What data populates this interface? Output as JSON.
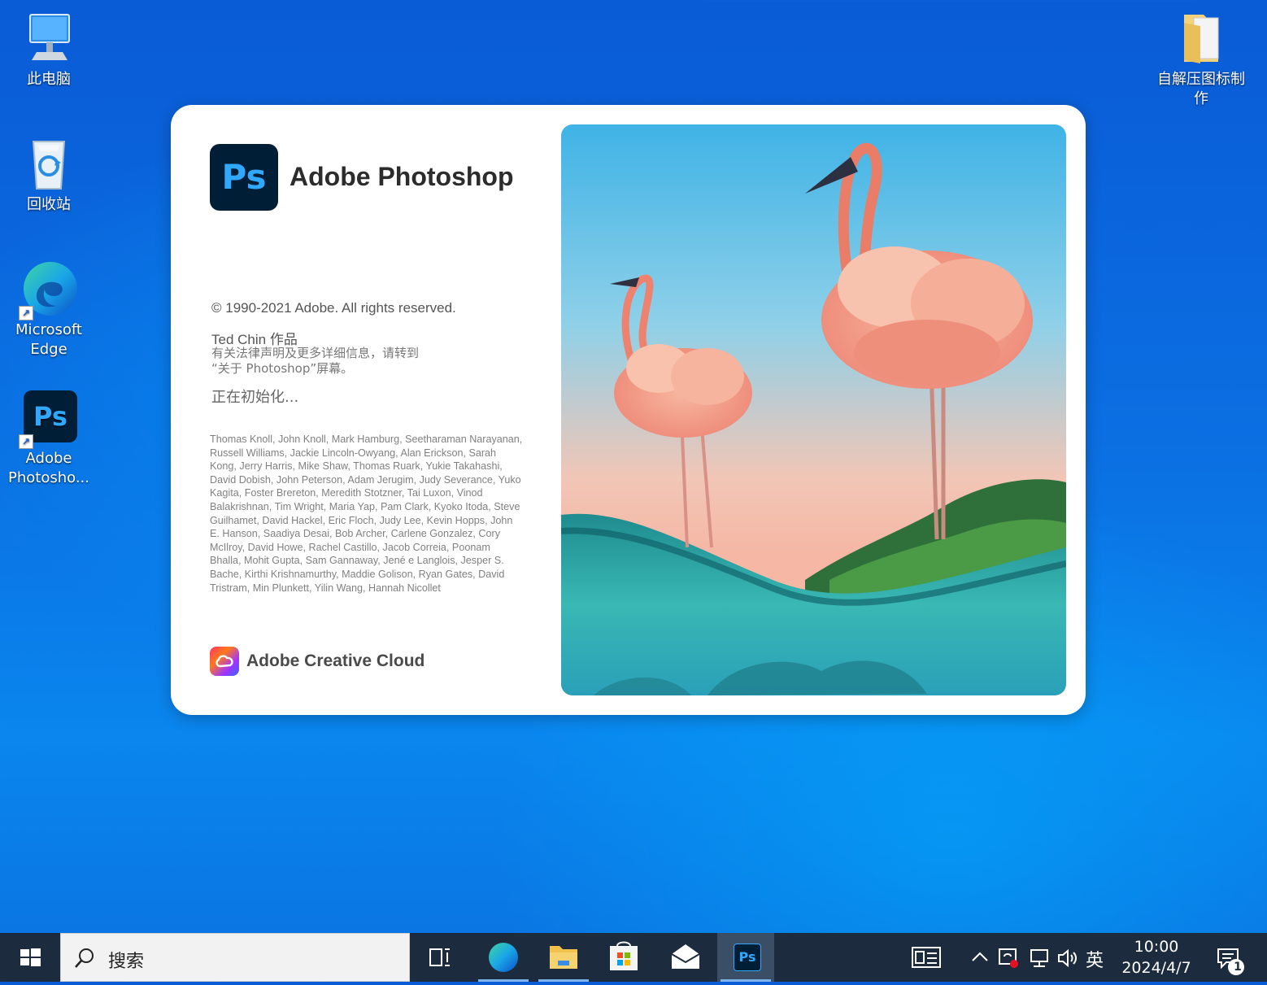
{
  "desktop": {
    "icons": [
      {
        "label": "此电脑"
      },
      {
        "label": "回收站"
      },
      {
        "label_line1": "Microsoft",
        "label_line2": "Edge"
      },
      {
        "label_line1": "Adobe",
        "label_line2": "Photosho..."
      },
      {
        "label_line1": "自解压图标制",
        "label_line2": "作"
      }
    ]
  },
  "splash": {
    "logo_text": "Ps",
    "title": "Adobe Photoshop",
    "copyright": "© 1990-2021 Adobe. All rights reserved.",
    "author": "Ted Chin 作品",
    "legal_line1": "有关法律声明及更多详细信息，请转到",
    "legal_line2": "“关于 Photoshop”屏幕。",
    "status": "正在初始化...",
    "credits": "Thomas Knoll, John Knoll, Mark Hamburg, Seetharaman Narayanan, Russell Williams, Jackie Lincoln-Owyang, Alan Erickson, Sarah Kong, Jerry Harris, Mike Shaw, Thomas Ruark, Yukie Takahashi, David Dobish, John Peterson, Adam Jerugim, Judy Severance, Yuko Kagita, Foster Brereton, Meredith Stotzner, Tai Luxon, Vinod Balakrishnan, Tim Wright, Maria Yap, Pam Clark, Kyoko Itoda, Steve Guilhamet, David Hackel, Eric Floch, Judy Lee, Kevin Hopps, John E. Hanson, Saadiya Desai, Bob Archer, Carlene Gonzalez, Cory McIlroy, David Howe, Rachel Castillo, Jacob Correia, Poonam Bhalla, Mohit Gupta, Sam Gannaway, Jené e Langlois, Jesper S. Bache, Kirthi Krishnamurthy, Maddie Golison, Ryan Gates, David Tristram, Min Plunkett, Yilin Wang, Hannah Nicollet",
    "footer": "Adobe Creative Cloud"
  },
  "taskbar": {
    "search_placeholder": "搜索",
    "ps_label": "Ps",
    "ime": "英",
    "time": "10:00",
    "date": "2024/4/7",
    "notification_count": "1"
  },
  "colors": {
    "ps_dark": "#001e36",
    "ps_blue": "#31a8ff",
    "taskbar": "#1c2c3e"
  }
}
